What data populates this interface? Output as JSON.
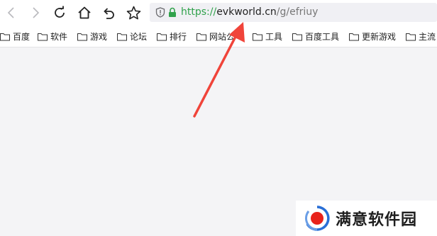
{
  "toolbar": {
    "back_icon": "chevron-left-icon",
    "forward_icon": "chevron-right-icon",
    "reload_icon": "reload-icon",
    "home_icon": "home-icon",
    "undo_icon": "undo-icon",
    "bookmark_icon": "star-icon"
  },
  "address_bar": {
    "scheme": "https://",
    "host": "evkworld.cn",
    "path": "/g/efriuy",
    "secure_color": "#31a24c"
  },
  "bookmarks": [
    {
      "label": "百度"
    },
    {
      "label": "软件"
    },
    {
      "label": "游戏"
    },
    {
      "label": "论坛"
    },
    {
      "label": "排行"
    },
    {
      "label": "网站公"
    },
    {
      "label": "工具"
    },
    {
      "label": "百度工具"
    },
    {
      "label": "更新游戏"
    },
    {
      "label": "主流"
    }
  ],
  "annotation": {
    "arrow_color": "#f0443a"
  },
  "watermark": {
    "text": "满意软件园",
    "logo_color": "#e8221b"
  }
}
